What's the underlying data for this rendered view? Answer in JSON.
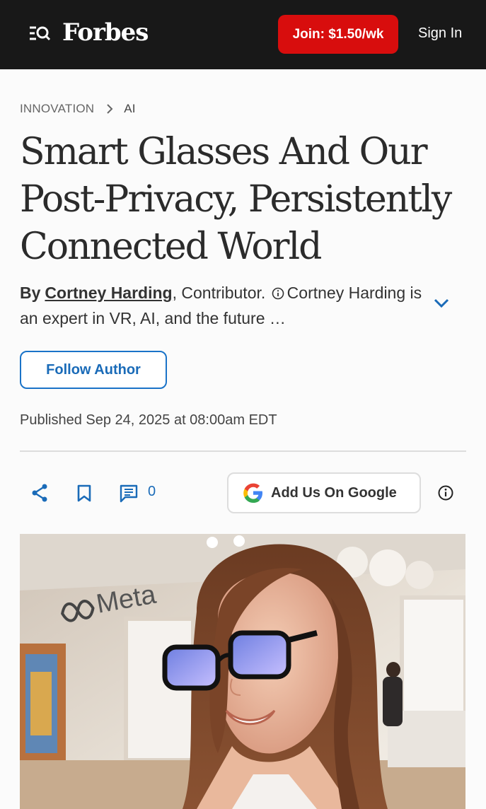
{
  "header": {
    "logo": "Forbes",
    "join_label": "Join: $1.50/wk",
    "signin_label": "Sign In"
  },
  "breadcrumb": {
    "section": "INNOVATION",
    "subsection": "AI"
  },
  "article": {
    "headline": "Smart Glasses And Our Post-Privacy, Persistently Connected World",
    "by_label": "By",
    "author": "Cortney Harding",
    "role": ", Contributor.",
    "bio": "Cortney Harding is an expert in VR, AI, and the future …",
    "follow_label": "Follow Author",
    "published": "Published Sep 24, 2025 at 08:00am EDT"
  },
  "actions": {
    "comment_count": "0",
    "google_label": "Add Us On Google"
  },
  "hero_image": {
    "sign_text": "Meta"
  },
  "colors": {
    "topbar": "#181818",
    "join_red": "#d80d0d",
    "link_blue": "#1a6bb8"
  }
}
